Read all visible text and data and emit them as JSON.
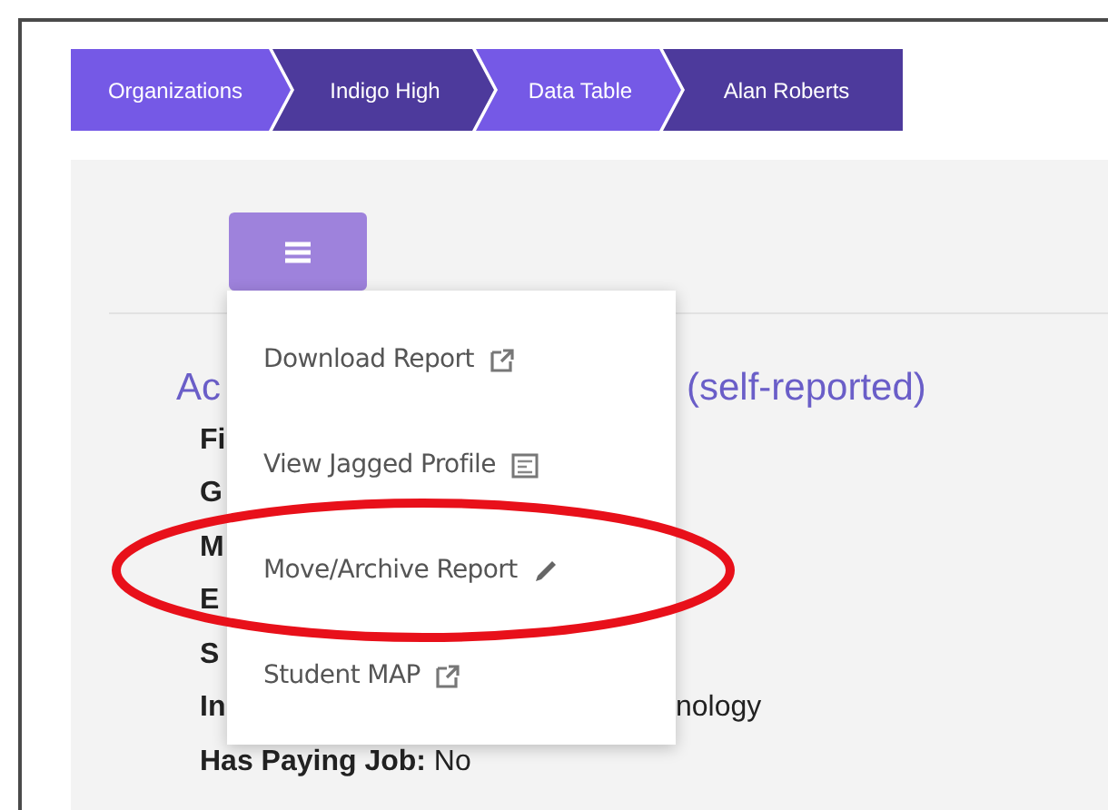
{
  "breadcrumb": [
    {
      "label": "Organizations"
    },
    {
      "label": "Indigo High"
    },
    {
      "label": "Data Table"
    },
    {
      "label": "Alan Roberts"
    }
  ],
  "panel": {
    "heading_start": "Ac",
    "heading_end": "(self-reported)",
    "rows": [
      {
        "label": "Fi"
      },
      {
        "label": "G"
      },
      {
        "label": "M"
      },
      {
        "label": "E"
      },
      {
        "label": "S"
      },
      {
        "label": "In",
        "value_end": "nology"
      },
      {
        "label": "Has Paying Job:",
        "value": "No"
      }
    ]
  },
  "menu": {
    "expanded": true,
    "items": [
      {
        "label": "Download Report",
        "kind": "external"
      },
      {
        "label": "View Jagged Profile",
        "kind": "view"
      },
      {
        "label": "Move/Archive Report",
        "kind": "edit"
      },
      {
        "label": "Student MAP",
        "kind": "external"
      }
    ]
  }
}
